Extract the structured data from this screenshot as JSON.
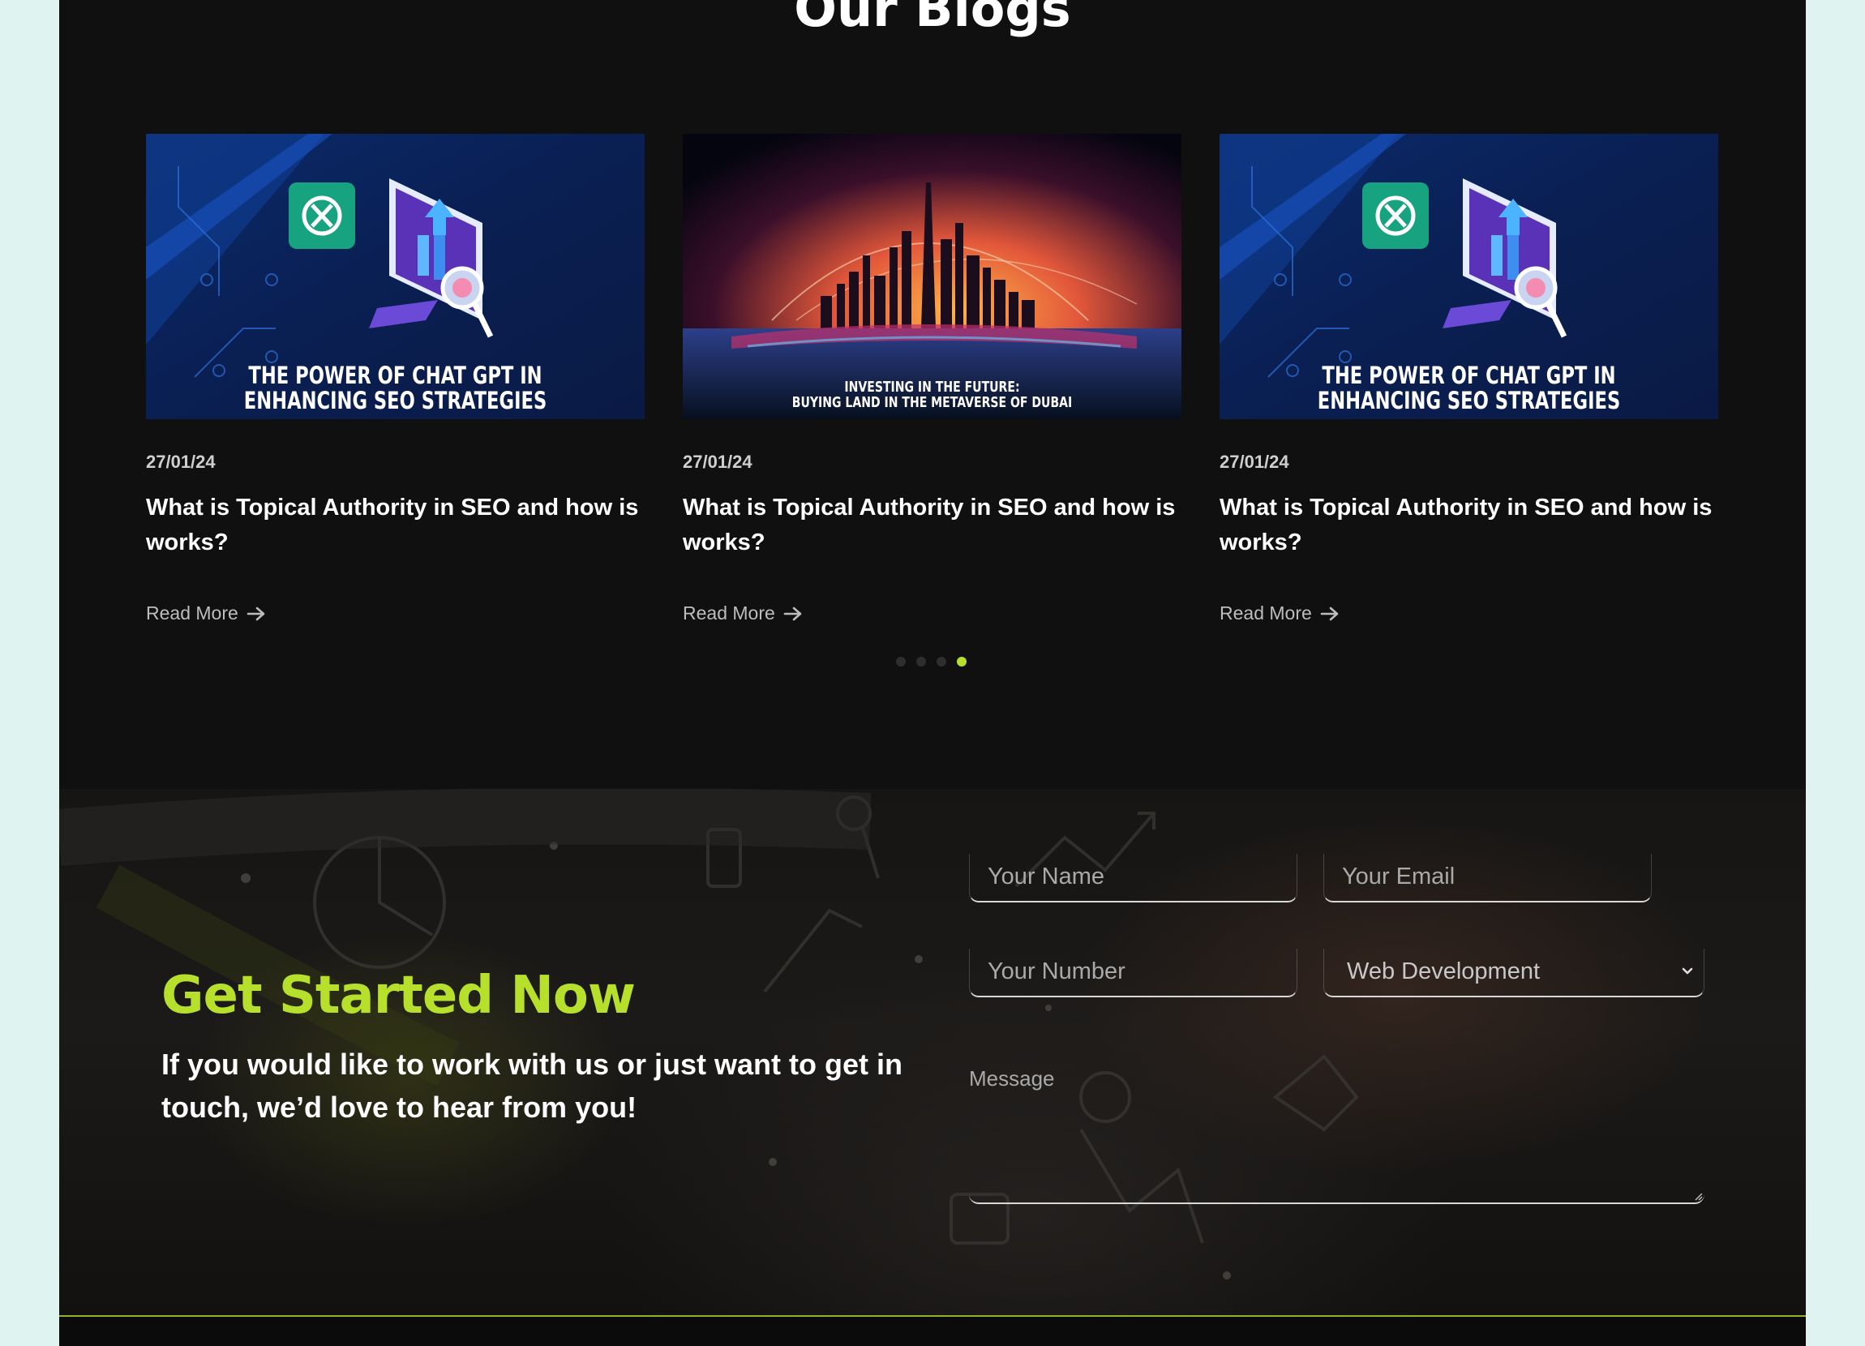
{
  "blogs": {
    "title": "Our Blogs",
    "posts": [
      {
        "image_caption_line1": "THE POWER OF CHAT GPT IN",
        "image_caption_line2": "ENHANCING SEO STRATEGIES",
        "date": "27/01/24",
        "title": "What is Topical Authority in SEO and how is works?",
        "read_more": "Read More"
      },
      {
        "image_caption_line1": "INVESTING IN THE FUTURE:",
        "image_caption_line2": "BUYING LAND IN THE METAVERSE OF DUBAI",
        "date": "27/01/24",
        "title": "What is Topical Authority in SEO and how is works?",
        "read_more": "Read More"
      },
      {
        "image_caption_line1": "THE POWER OF CHAT GPT IN",
        "image_caption_line2": "ENHANCING SEO STRATEGIES",
        "date": "27/01/24",
        "title": "What is Topical Authority in SEO and how is works?",
        "read_more": "Read More"
      }
    ],
    "carousel": {
      "dot_count": 4,
      "active_dot": 4
    }
  },
  "contact": {
    "heading": "Get Started Now",
    "subheading": "If you would like to work with us or just want to get in touch, we’d love to hear from you!",
    "form": {
      "name_placeholder": "Your Name",
      "email_placeholder": "Your Email",
      "number_placeholder": "Your Number",
      "service_selected": "Web Development",
      "message_placeholder": "Message"
    }
  },
  "colors": {
    "accent": "#b6e02c",
    "page_bg": "#101010",
    "outer_bg": "#dff3f1"
  },
  "icons": {
    "read_more": "arrow-right-icon",
    "select": "chevron-down-icon",
    "openai": "openai-logo-icon"
  }
}
